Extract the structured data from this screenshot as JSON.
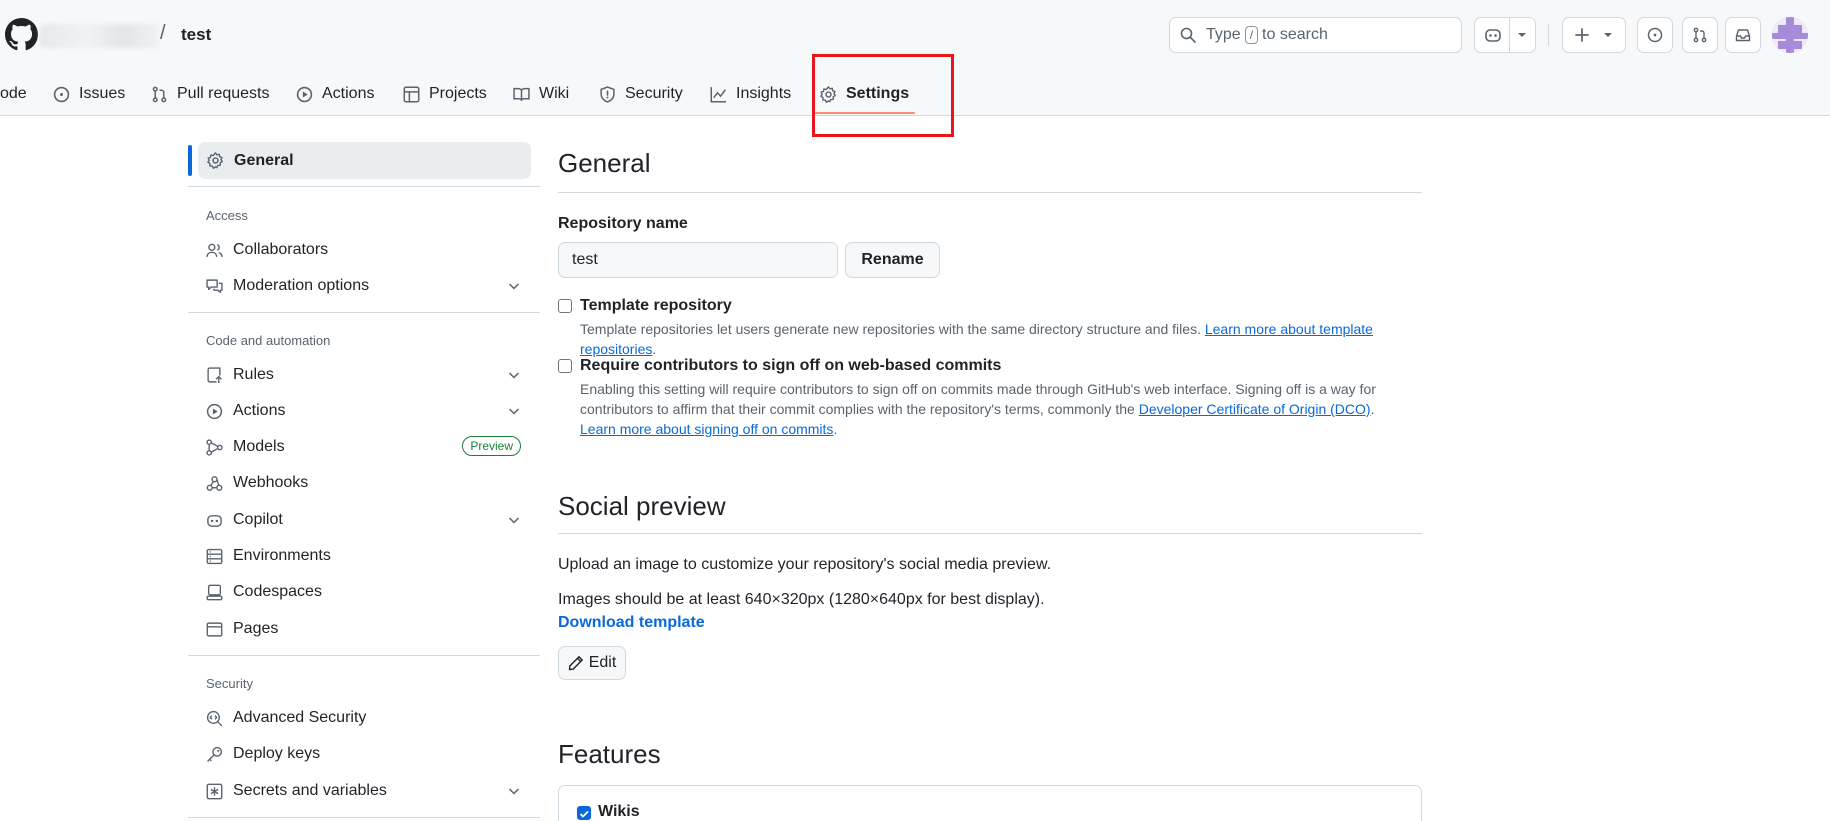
{
  "header": {
    "repo_separator": "/",
    "repo_name": "test",
    "search": {
      "prefix": "Type",
      "key": "/",
      "suffix": "to search"
    },
    "buttons": [
      "copilot-icon",
      "plus-icon",
      "issue-opened-icon",
      "pull-request-icon",
      "inbox-icon"
    ]
  },
  "repo_nav": {
    "items": [
      {
        "label": "ode",
        "icon": "code-icon"
      },
      {
        "label": "Issues",
        "icon": "issue-icon"
      },
      {
        "label": "Pull requests",
        "icon": "pull-request-icon"
      },
      {
        "label": "Actions",
        "icon": "play-icon"
      },
      {
        "label": "Projects",
        "icon": "table-icon"
      },
      {
        "label": "Wiki",
        "icon": "book-icon"
      },
      {
        "label": "Security",
        "icon": "shield-icon"
      },
      {
        "label": "Insights",
        "icon": "graph-icon"
      },
      {
        "label": "Settings",
        "icon": "gear-icon",
        "selected": true
      }
    ]
  },
  "sidebar": {
    "active": "General",
    "sections": [
      {
        "heading": "Access",
        "items": [
          {
            "label": "Collaborators",
            "icon": "people-icon"
          },
          {
            "label": "Moderation options",
            "icon": "comment-discussion-icon",
            "expandable": true
          }
        ]
      },
      {
        "heading": "Code and automation",
        "items": [
          {
            "label": "Rules",
            "icon": "repo-push-icon",
            "expandable": true
          },
          {
            "label": "Actions",
            "icon": "play-icon",
            "expandable": true
          },
          {
            "label": "Models",
            "icon": "workflow-icon",
            "badge": "Preview"
          },
          {
            "label": "Webhooks",
            "icon": "webhook-icon"
          },
          {
            "label": "Copilot",
            "icon": "copilot-icon",
            "expandable": true
          },
          {
            "label": "Environments",
            "icon": "server-icon"
          },
          {
            "label": "Codespaces",
            "icon": "codespaces-icon"
          },
          {
            "label": "Pages",
            "icon": "browser-icon"
          }
        ]
      },
      {
        "heading": "Security",
        "items": [
          {
            "label": "Advanced Security",
            "icon": "codescan-icon"
          },
          {
            "label": "Deploy keys",
            "icon": "key-icon"
          },
          {
            "label": "Secrets and variables",
            "icon": "asterisk-icon",
            "expandable": true
          }
        ]
      }
    ]
  },
  "main": {
    "general_title": "General",
    "repo_name_label": "Repository name",
    "repo_name_value": "test",
    "rename_button": "Rename",
    "template": {
      "title": "Template repository",
      "text": "Template repositories let users generate new repositories with the same directory structure and files.",
      "link": "Learn more about template repositories",
      "tail": "."
    },
    "signoff": {
      "title": "Require contributors to sign off on web-based commits",
      "text1": "Enabling this setting will require contributors to sign off on commits made through GitHub's web interface. Signing off is a way for contributors to affirm that their commit complies with the repository's terms, commonly the",
      "link1": "Developer Certificate of Origin (DCO)",
      "mid": ".",
      "link2": "Learn more about signing off on commits",
      "tail": "."
    },
    "social_title": "Social preview",
    "social_text1": "Upload an image to customize your repository's social media preview.",
    "social_text2": "Images should be at least 640×320px (1280×640px for best display).",
    "download_template": "Download template",
    "edit_button": "Edit",
    "features_title": "Features",
    "wikis_label": "Wikis",
    "wikis_checked": true
  },
  "colors": {
    "accent": "#0969da",
    "highlight": "#e5161c",
    "underline": "#fd8c73",
    "preview": "#1a7f37"
  }
}
